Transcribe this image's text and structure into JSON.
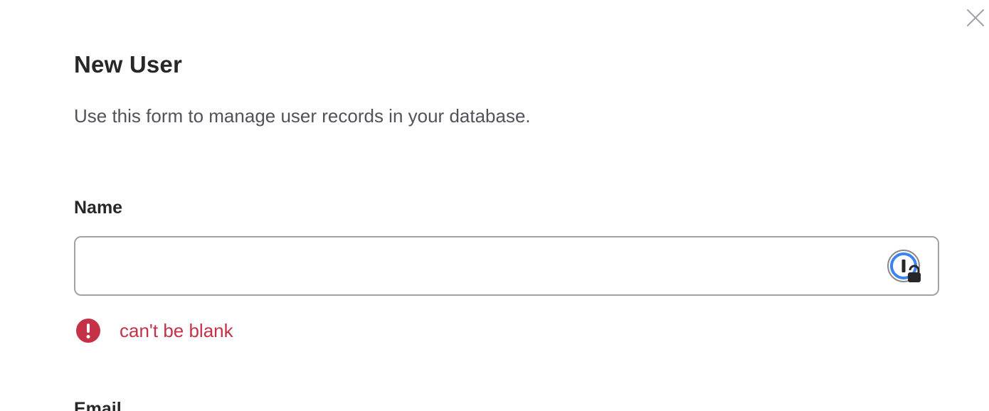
{
  "dialog": {
    "title": "New User",
    "description": "Use this form to manage user records in your database."
  },
  "form": {
    "name": {
      "label": "Name",
      "value": "",
      "error": "can't be blank"
    },
    "email": {
      "label": "Email"
    }
  },
  "icons": {
    "close": "close-icon",
    "password_manager": "password-manager-icon",
    "error": "error-exclamation-icon"
  },
  "colors": {
    "error": "#c53146",
    "pm_blue": "#3b82f6",
    "input_border": "#a1a1aa"
  }
}
